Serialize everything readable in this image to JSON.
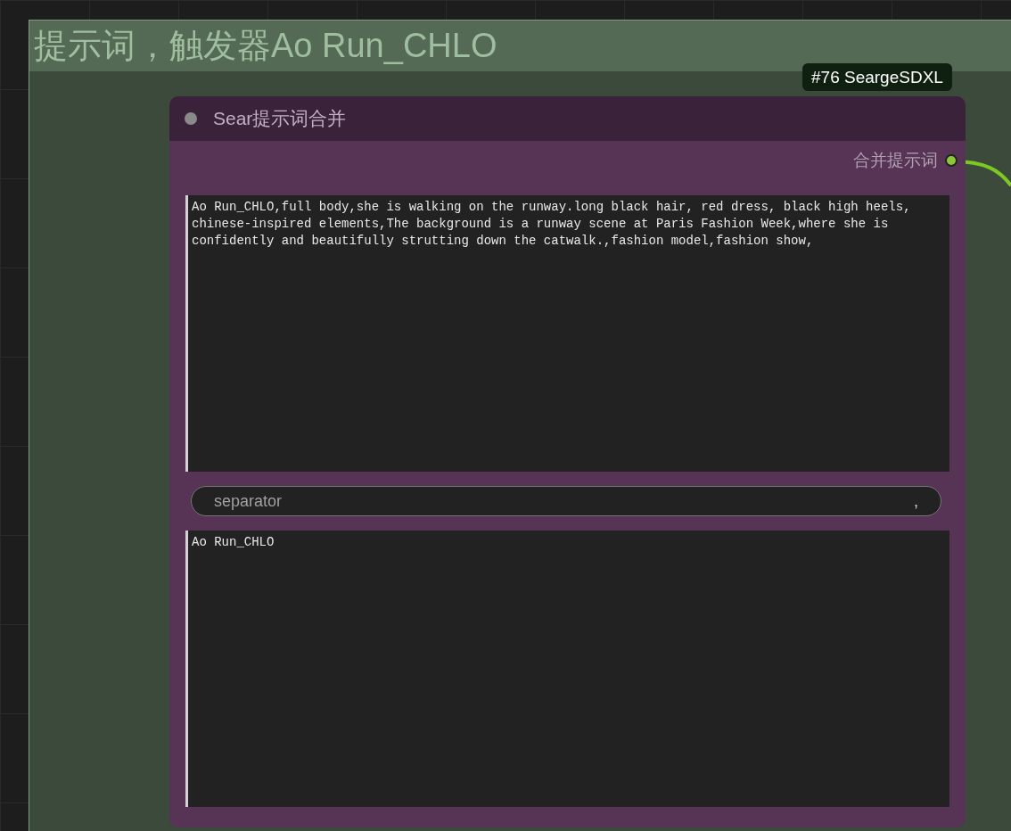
{
  "group": {
    "title": "提示词，触发器Ao Run_CHLO"
  },
  "node": {
    "badge": "#76 SeargeSDXL",
    "title": "Sear提示词合并",
    "outputs": [
      {
        "label": "合并提示词",
        "connected": true
      }
    ],
    "widgets": [
      {
        "kind": "textarea",
        "value": "Ao Run_CHLO,full body,she is walking on the runway.long black hair, red dress, black high heels, chinese-inspired elements,The background is a runway scene at Paris Fashion Week,where she is confidently and beautifully strutting down the catwalk.,fashion model,fashion show,"
      },
      {
        "kind": "text",
        "label": "separator",
        "value": ","
      },
      {
        "kind": "textarea",
        "value": "Ao Run_CHLO"
      }
    ]
  }
}
